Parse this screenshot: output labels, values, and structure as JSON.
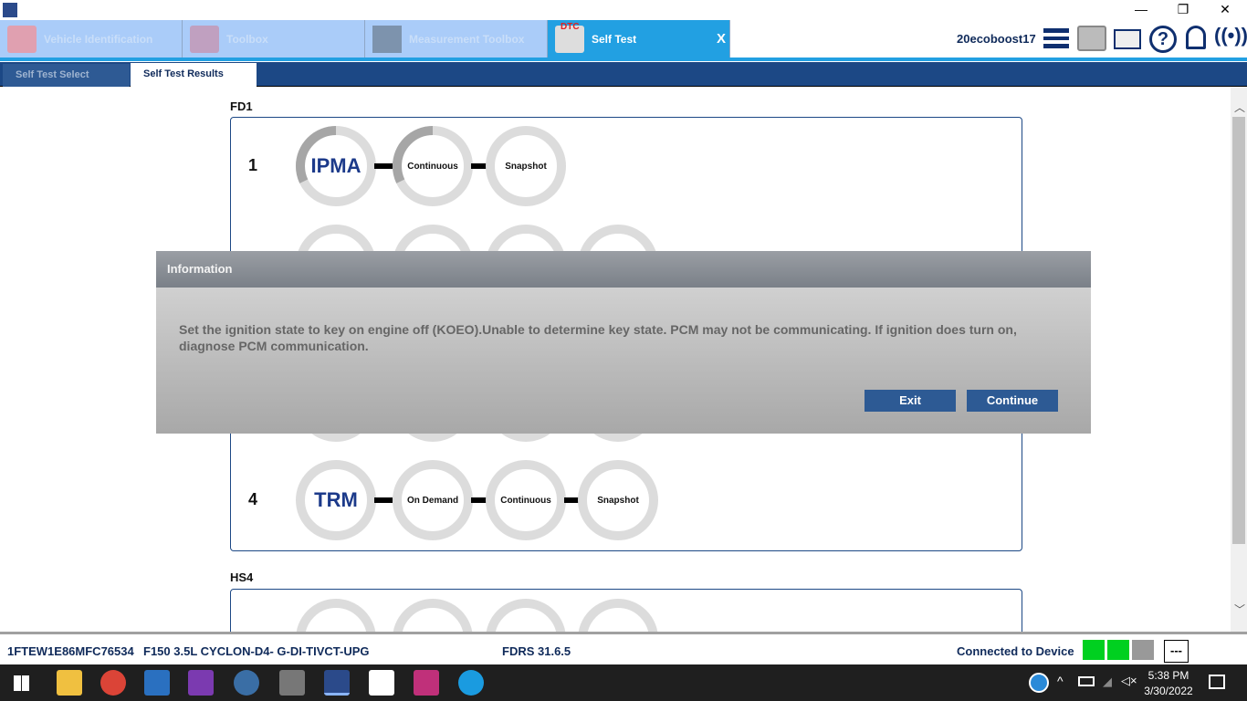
{
  "app": {
    "title_logo": "FDRS"
  },
  "window_controls": {
    "minimize": "—",
    "restore": "❐",
    "close": "✕"
  },
  "app_tabs": [
    {
      "label": "Vehicle Identification",
      "icon": "car-icon"
    },
    {
      "label": "Toolbox",
      "icon": "toolbox-icon"
    },
    {
      "label": "Measurement Toolbox",
      "icon": "waveform-icon"
    },
    {
      "label": "Self Test",
      "icon": "dtc-scanner-icon",
      "active": true,
      "close": "X"
    }
  ],
  "header": {
    "username": "20ecoboost17",
    "icons": [
      "menu-icon",
      "printer-icon",
      "mail-icon",
      "help-icon",
      "bell-icon",
      "wireless-icon"
    ],
    "help_glyph": "?"
  },
  "sub_tabs": [
    {
      "label": "Self Test Select"
    },
    {
      "label": "Self Test Results",
      "active": true
    }
  ],
  "groups": [
    {
      "name": "FD1",
      "rows": [
        {
          "num": "1",
          "module": "IPMA",
          "steps": [
            "Continuous",
            "Snapshot"
          ],
          "in_progress": true
        },
        {
          "num": "",
          "module": "",
          "steps": [
            "",
            "",
            ""
          ]
        },
        {
          "num": "",
          "module": "",
          "steps": [
            "",
            "",
            ""
          ]
        },
        {
          "num": "4",
          "module": "TRM",
          "steps": [
            "On Demand",
            "Continuous",
            "Snapshot"
          ]
        }
      ]
    },
    {
      "name": "HS4",
      "rows": [
        {
          "num": "",
          "module": "",
          "steps": [
            "",
            "",
            ""
          ]
        }
      ]
    }
  ],
  "dialog": {
    "title": "Information",
    "message": "Set the ignition state to key on engine off (KOEO).Unable to determine key state. PCM may not be communicating. If ignition does turn on, diagnose PCM communication.",
    "exit_label": "Exit",
    "continue_label": "Continue"
  },
  "status": {
    "vin": "1FTEW1E86MFC76534",
    "vehicle": "F150 3.5L CYCLON-D4- G-DI-TIVCT-UPG",
    "version": "FDRS 31.6.5",
    "connection": "Connected to Device",
    "indicator": "---"
  },
  "taskbar": {
    "time": "5:38 PM",
    "date": "3/30/2022"
  },
  "colors": {
    "accent": "#22a0e2",
    "navy": "#1c4885",
    "button": "#2d5a94",
    "connected_green": "#00d020"
  }
}
